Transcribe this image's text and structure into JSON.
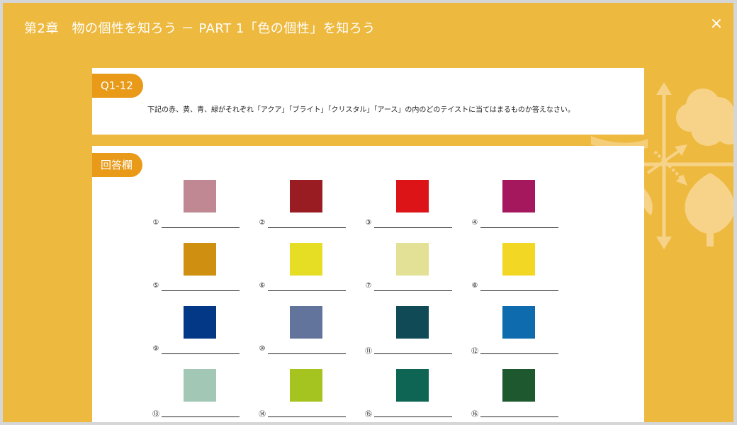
{
  "header": {
    "title": "第2章　物の個性を知ろう － PART 1「色の個性」を知ろう",
    "close_label": "×"
  },
  "question": {
    "tag": "Q1-12",
    "text": "下記の赤、黄、青、緑がそれぞれ「アクア」「ブライト」「クリスタル」「アース」の内のどのテイストに当てはまるものか答えなさい。"
  },
  "answer": {
    "tag": "回答欄",
    "items": [
      {
        "num": "①",
        "color": "#bf8893"
      },
      {
        "num": "②",
        "color": "#981c22"
      },
      {
        "num": "③",
        "color": "#dc1317"
      },
      {
        "num": "④",
        "color": "#a5185d"
      },
      {
        "num": "⑤",
        "color": "#cf8f11"
      },
      {
        "num": "⑥",
        "color": "#e6dd25"
      },
      {
        "num": "⑦",
        "color": "#e2e196"
      },
      {
        "num": "⑧",
        "color": "#f2d824"
      },
      {
        "num": "⑨",
        "color": "#033887"
      },
      {
        "num": "⑩",
        "color": "#62749c"
      },
      {
        "num": "⑪",
        "color": "#114a57"
      },
      {
        "num": "⑫",
        "color": "#0e6bad"
      },
      {
        "num": "⑬",
        "color": "#a2c8b5"
      },
      {
        "num": "⑭",
        "color": "#a6c41f"
      },
      {
        "num": "⑮",
        "color": "#0e6554"
      },
      {
        "num": "⑯",
        "color": "#1d582f"
      }
    ]
  },
  "theme": {
    "background": "#eeb93f",
    "tag_color": "#e89a18",
    "decoration_color": "#f6d389"
  }
}
